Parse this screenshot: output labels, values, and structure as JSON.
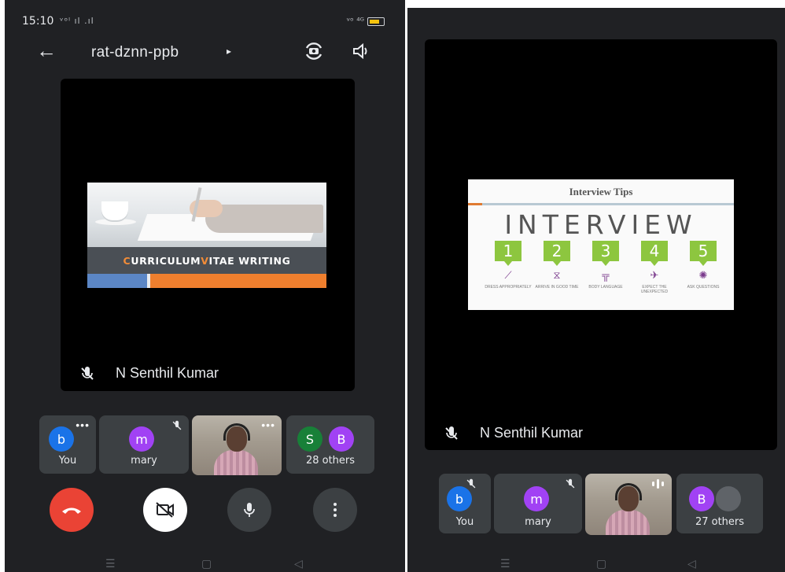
{
  "left_screen": {
    "status_bar": {
      "time": "15:10",
      "signal": "ᵛᵒˡ ıl .ıl",
      "right": "ᵛᵒ ⁴ᴳ"
    },
    "top_bar": {
      "meeting_code": "rat-dznn-ppb",
      "caret": "▸"
    },
    "presenter_name": "N Senthil Kumar",
    "slide": {
      "title_parts": [
        "C",
        "URRICULUM ",
        "V",
        "ITAE WRITING"
      ]
    },
    "participants": [
      {
        "initial": "b",
        "label": "You",
        "color": "#1a73e8"
      },
      {
        "initial": "m",
        "label": "mary",
        "color": "#a142f4"
      },
      {
        "type": "video"
      },
      {
        "initials": [
          "S",
          "B"
        ],
        "colors": [
          "#188038",
          "#a142f4"
        ],
        "label": "28 others"
      }
    ],
    "more_dots": "•••"
  },
  "right_screen": {
    "presenter_name": "N Senthil Kumar",
    "slide": {
      "title": "Interview Tips",
      "word": "INTERVIEW",
      "steps": [
        {
          "num": "1",
          "caption": "DRESS APPROPRIATELY",
          "glyph": "⟋"
        },
        {
          "num": "2",
          "caption": "ARRIVE IN GOOD TIME",
          "glyph": "⧖"
        },
        {
          "num": "3",
          "caption": "BODY LANGUAGE",
          "glyph": "╦"
        },
        {
          "num": "4",
          "caption": "EXPECT THE UNEXPECTED",
          "glyph": "✈"
        },
        {
          "num": "5",
          "caption": "ASK QUESTIONS",
          "glyph": "✺"
        }
      ]
    },
    "participants": [
      {
        "initial": "b",
        "label": "You",
        "color": "#1a73e8"
      },
      {
        "initial": "m",
        "label": "mary",
        "color": "#a142f4"
      },
      {
        "type": "video"
      },
      {
        "initials": [
          "B"
        ],
        "colors": [
          "#a142f4"
        ],
        "label": "27 others"
      }
    ]
  },
  "colors": {
    "background": "#202124",
    "tile": "#3c4043",
    "end_call": "#ea4335",
    "accent_green": "#8dc63f",
    "accent_orange": "#ef7f2e"
  },
  "nav_glyphs": {
    "menu": "☰",
    "home": "▢",
    "back": "◁"
  }
}
